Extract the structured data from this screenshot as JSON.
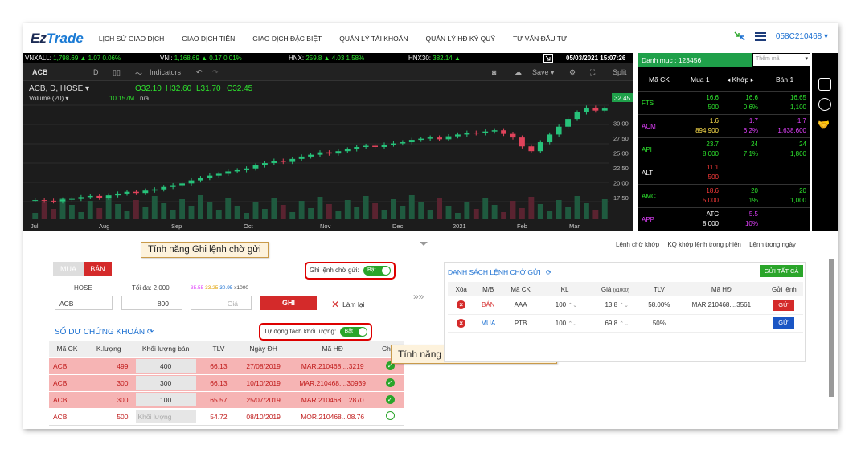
{
  "brand": {
    "part1": "Ez",
    "part2": "Trade"
  },
  "menu": [
    "LỊCH SỬ GIAO DỊCH",
    "GIAO DỊCH TIỀN",
    "GIAO DỊCH ĐẶC BIỆT",
    "QUẢN LÝ TÀI KHOẢN",
    "QUẢN LÝ HĐ KỲ QUỸ",
    "TƯ VẤN ĐẦU TƯ"
  ],
  "account": "058C210468 ▾",
  "indices": {
    "vnxall_label": "VNXALL:",
    "vnxall_value": "1,798.69 ▲ 1.07 0.06%",
    "vni_label": "VNI:",
    "vni_value": "1,168.69 ▲ 0.17 0.01%",
    "hnx_label": "HNX:",
    "hnx_value": "259.8 ▲ 4.03 1.58%",
    "hnx30_label": "HNX30:",
    "hnx30_value": "382.14 ▲",
    "datetime": "05/03/2021 15:07:26"
  },
  "chart_toolbar": {
    "symbol": "ACB",
    "interval": "D",
    "indicators": "Indicators",
    "save": "Save ▾",
    "split": "Split"
  },
  "chart_data": {
    "type": "candlestick",
    "title": "ACB, D, HOSE ▾",
    "ohlc_text": {
      "o": "O32.10",
      "h": "H32.60",
      "l": "L31.70",
      "c": "C32.45"
    },
    "volume_label": "Volume (20) ▾",
    "volume_value": "10.157M",
    "volume_na": "n/a",
    "last_price_label": "32.45",
    "yticks": [
      "30.00",
      "27.50",
      "25.00",
      "22.50",
      "20.00",
      "17.50"
    ],
    "xticks": [
      "Jul",
      "Aug",
      "Sep",
      "Oct",
      "Nov",
      "Dec",
      "2021",
      "Feb",
      "Mar"
    ],
    "ylim": [
      15.5,
      33
    ],
    "closes": [
      17.1,
      17.0,
      16.9,
      17.2,
      17.3,
      17.6,
      17.8,
      17.5,
      17.9,
      18.2,
      18.5,
      18.3,
      18.7,
      18.9,
      19.3,
      19.6,
      19.9,
      20.4,
      20.8,
      21.2,
      21.5,
      21.9,
      22.1,
      22.4,
      22.9,
      23.3,
      23.7,
      23.5,
      24.0,
      24.4,
      24.7,
      25.1,
      24.9,
      25.3,
      25.6,
      26.0,
      26.2,
      26.0,
      26.4,
      26.6,
      26.8,
      27.2,
      27.4,
      27.6,
      27.3,
      27.8,
      28.1,
      28.4,
      28.3,
      28.6,
      28.8,
      28.2,
      27.6,
      26.1,
      25.3,
      26.8,
      28.1,
      29.4,
      30.7,
      31.8,
      32.6,
      32.1,
      32.45
    ]
  },
  "watchlist": {
    "title": "Danh mục : 123456",
    "add_placeholder": "Thêm mã",
    "headers": [
      "Mã CK",
      "Mua 1",
      "◂ Khớp ▸",
      "Bán 1"
    ],
    "rows": [
      {
        "sym": "FTS",
        "sym_color": "#2ee52e",
        "mua_p": "16.6",
        "mua_v": "500",
        "khop_p": "16.6",
        "khop_v": "0.6%",
        "ban_p": "16.65",
        "ban_v": "1,100",
        "c1": "#2ee52e",
        "c2": "#2ee52e",
        "c3": "#2ee52e"
      },
      {
        "sym": "ACM",
        "sym_color": "#e040fb",
        "mua_p": "1.6",
        "mua_v": "894,900",
        "khop_p": "1.7",
        "khop_v": "6.2%",
        "ban_p": "1.7",
        "ban_v": "1,638,600",
        "c1": "#ffe14d",
        "c2": "#e040fb",
        "c3": "#e040fb"
      },
      {
        "sym": "API",
        "sym_color": "#2ee52e",
        "mua_p": "23.7",
        "mua_v": "8,000",
        "khop_p": "24",
        "khop_v": "7.1%",
        "ban_p": "24",
        "ban_v": "1,800",
        "c1": "#2ee52e",
        "c2": "#2ee52e",
        "c3": "#2ee52e"
      },
      {
        "sym": "ALT",
        "sym_color": "#ffffff",
        "mua_p": "11.1",
        "mua_v": "500",
        "khop_p": "",
        "khop_v": "",
        "ban_p": "",
        "ban_v": "",
        "c1": "#ff3b3b",
        "c2": "#ffffff",
        "c3": "#ffffff"
      },
      {
        "sym": "AMC",
        "sym_color": "#2ee52e",
        "mua_p": "18.6",
        "mua_v": "5,000",
        "khop_p": "20",
        "khop_v": "1%",
        "ban_p": "20",
        "ban_v": "1,000",
        "c1": "#ff3b3b",
        "c2": "#2ee52e",
        "c3": "#2ee52e"
      },
      {
        "sym": "APP",
        "sym_color": "#e040fb",
        "mua_p": "ATC",
        "mua_v": "8,000",
        "khop_p": "5.5",
        "khop_v": "10%",
        "ban_p": "",
        "ban_v": "",
        "c1": "#ffffff",
        "c2": "#e040fb",
        "c3": "#ffffff"
      }
    ]
  },
  "subtabs": [
    "Lệnh chờ khớp",
    "KQ khớp lệnh trong phiên",
    "Lệnh trong ngày"
  ],
  "order_form": {
    "buy_tab": "MUA",
    "sell_tab": "BÁN",
    "hose_label": "HOSE",
    "symbol_value": "ACB",
    "max_label": "Tối đa: 2,000",
    "qty_value": "800",
    "price_refs": {
      "ceil": "35.55",
      "ref": "33.25",
      "floor": "30.95",
      "unit": "x1000"
    },
    "price_placeholder": "Giá",
    "submit": "GHI",
    "reset": "Làm lại",
    "pending_toggle_label": "Ghi lệnh chờ gửi:",
    "pending_toggle_state": "Bật"
  },
  "callouts": {
    "top": "Tính năng Ghi lệnh chờ gửi",
    "bottom": "Tính năng Tự động tách khối lượng"
  },
  "holdings": {
    "title": "SỐ DƯ CHỨNG KHOÁN",
    "auto_split_label": "Tự động tách khối lượng:",
    "auto_split_state": "Bật",
    "headers": [
      "Mã CK",
      "K.lượng",
      "Khối lượng bán",
      "TLV",
      "Ngày ĐH",
      "Mã HĐ",
      "Chọn"
    ],
    "rows": [
      {
        "sym": "ACB",
        "qty": "499",
        "sell": "400",
        "tlv": "66.13",
        "date": "27/08/2019",
        "contract": "MAR.210468....3219",
        "checked": "✓"
      },
      {
        "sym": "ACB",
        "qty": "300",
        "sell": "300",
        "tlv": "66.13",
        "date": "10/10/2019",
        "contract": "MAR.210468....30939",
        "checked": "✓"
      },
      {
        "sym": "ACB",
        "qty": "300",
        "sell": "100",
        "tlv": "65.57",
        "date": "25/07/2019",
        "contract": "MAR.210468....2870",
        "checked": "✓"
      },
      {
        "sym": "ACB",
        "qty": "500",
        "sell": "Khối lượng",
        "tlv": "54.72",
        "date": "08/10/2019",
        "contract": "MOR.210468...08.76",
        "checked": ""
      }
    ]
  },
  "pending": {
    "title": "DANH SÁCH LỆNH CHỜ GỬI",
    "send_all": "GỬI TẤT CẢ",
    "headers": [
      "Xóa",
      "M/B",
      "Mã CK",
      "KL",
      "Giá",
      "TLV",
      "Mã HĐ",
      "Gửi lệnh"
    ],
    "price_unit": "(x1000)",
    "rows": [
      {
        "side": "BÁN",
        "side_color": "#d42a2a",
        "sym": "AAA",
        "qty": "100",
        "price": "13.8",
        "tlv": "58.00%",
        "contract": "MAR 210468....3561",
        "send": "GỬI",
        "btn": "red"
      },
      {
        "side": "MUA",
        "side_color": "#1a6fd1",
        "sym": "PTB",
        "qty": "100",
        "price": "69.8",
        "tlv": "50%",
        "contract": "",
        "send": "GỬI",
        "btn": "blue"
      }
    ]
  }
}
